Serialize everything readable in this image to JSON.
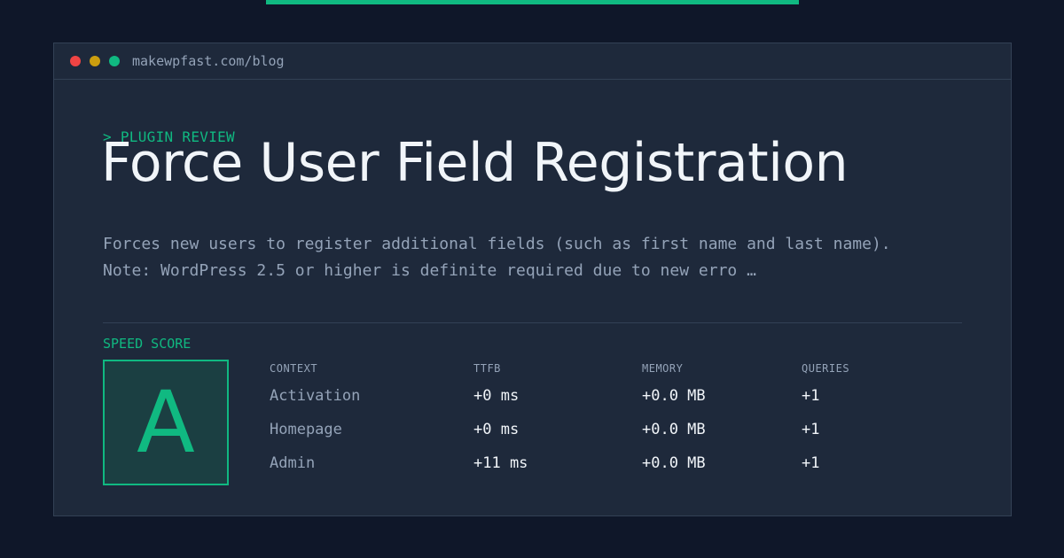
{
  "browser": {
    "url": "makewpfast.com/blog"
  },
  "colors": {
    "accent": "#10b981",
    "background": "#0f1729",
    "card": "#1e293b",
    "dot_red": "#ef4444",
    "dot_yellow": "#eab308",
    "dot_green": "#10b981"
  },
  "header": {
    "eyebrow": "> PLUGIN REVIEW",
    "title": "Force User Field Registration"
  },
  "description": {
    "line1": "Forces new users to register additional fields (such as first name and last name).",
    "line2": "Note: WordPress 2.5 or higher is definite required due to new erro …"
  },
  "score": {
    "label": "SPEED SCORE",
    "grade": "A"
  },
  "metrics": {
    "columns": [
      "CONTEXT",
      "TTFB",
      "MEMORY",
      "QUERIES"
    ],
    "rows": [
      [
        "Activation",
        "+0 ms",
        "+0.0 MB",
        "+1"
      ],
      [
        "Homepage",
        "+0 ms",
        "+0.0 MB",
        "+1"
      ],
      [
        "Admin",
        "+11 ms",
        "+0.0 MB",
        "+1"
      ]
    ]
  }
}
